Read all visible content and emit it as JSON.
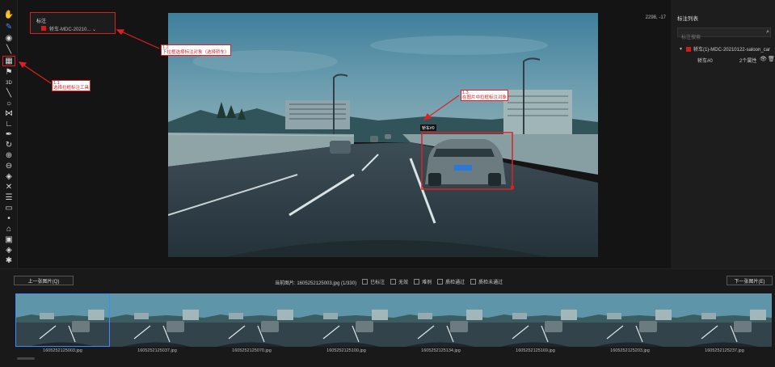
{
  "toolbar": {
    "tools": [
      {
        "name": "hand-tool-icon",
        "glyph": "✋"
      },
      {
        "name": "edit-tool-icon",
        "glyph": "✎",
        "active": true
      },
      {
        "name": "target-tool-icon",
        "glyph": "◉"
      },
      {
        "name": "line-tool-icon",
        "glyph": "╲"
      },
      {
        "name": "rect-tool-icon",
        "glyph": "▦",
        "boxed": true
      },
      {
        "name": "flag-tool-icon",
        "glyph": "⚑"
      },
      {
        "name": "3d-tool-icon",
        "glyph": "3D",
        "small": true
      },
      {
        "name": "polyline-tool-icon",
        "glyph": "╲"
      },
      {
        "name": "circle-tool-icon",
        "glyph": "○"
      },
      {
        "name": "bowtie-tool-icon",
        "glyph": "⋈"
      },
      {
        "name": "angle-tool-icon",
        "glyph": "∟"
      },
      {
        "name": "pen-tool-icon",
        "glyph": "✒"
      },
      {
        "name": "rotate-tool-icon",
        "glyph": "↻"
      },
      {
        "name": "zoom-in-icon",
        "glyph": "⊕"
      },
      {
        "name": "zoom-out-icon",
        "glyph": "⊖"
      },
      {
        "name": "layers-icon",
        "glyph": "◈"
      },
      {
        "name": "cross-tool-icon",
        "glyph": "✕"
      },
      {
        "name": "list-tool-icon",
        "glyph": "☰"
      },
      {
        "name": "image-tool-icon",
        "glyph": "▭"
      },
      {
        "name": "point-tool-icon",
        "glyph": "•"
      },
      {
        "name": "tag-tool-icon",
        "glyph": "⌂"
      },
      {
        "name": "monitor-tool-icon",
        "glyph": "▣"
      },
      {
        "name": "diamond-tool-icon",
        "glyph": "◈"
      },
      {
        "name": "settings-icon",
        "glyph": "✱"
      }
    ]
  },
  "popover": {
    "title": "标注",
    "selected": "轿车-MDC-20210...",
    "color": "#d41b1b"
  },
  "callouts": {
    "one": {
      "num": "1.2",
      "text": "下拉框选择标注对象（选择轿车）"
    },
    "two": {
      "num": "1.1",
      "text": "选择拉框标注工具"
    },
    "three": {
      "num": "1.3",
      "text": "在图片中拉框标注对象"
    }
  },
  "canvas": {
    "zoom_readout": "2298, -17",
    "box_label": "轿车#0"
  },
  "right_panel": {
    "title": "标注列表",
    "search_placeholder": "标注搜索",
    "group_label": "轿车(1)-MDC-20210122-saloon_car",
    "item_label": "轿车#0",
    "item_attrs": "2个属性",
    "group_color": "#d41b1b"
  },
  "bottom": {
    "prev_button": "上一张图片(Q)",
    "next_button": "下一张图片(E)",
    "current_image": "当前图片: 1605252125003.jpg (1/330)",
    "checks": [
      "已标注",
      "无效",
      "难例",
      "质检通过",
      "质检未通过"
    ],
    "thumbnails": [
      "1605252125003.jpg",
      "1605252125037.jpg",
      "1605252125070.jpg",
      "1605252125100.jpg",
      "1605252125134.jpg",
      "1605252125169.jpg",
      "1605252125203.jpg",
      "1605252125237.jpg"
    ]
  },
  "colors": {
    "accent": "#3b8cff",
    "annotation": "#e02020"
  }
}
